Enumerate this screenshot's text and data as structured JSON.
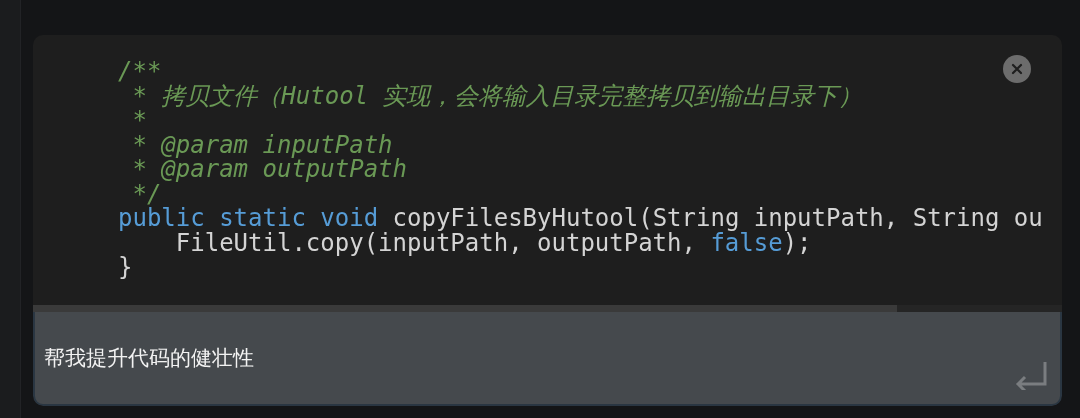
{
  "code_lines": [
    [
      {
        "kind": "comment",
        "text": "/**"
      }
    ],
    [
      {
        "kind": "comment",
        "text": " * 拷贝文件（Hutool 实现，会将输入目录完整拷贝到输出目录下）"
      }
    ],
    [
      {
        "kind": "comment",
        "text": " *"
      }
    ],
    [
      {
        "kind": "comment",
        "text": " * @param inputPath"
      }
    ],
    [
      {
        "kind": "comment",
        "text": " * @param outputPath"
      }
    ],
    [
      {
        "kind": "comment",
        "text": " */"
      }
    ],
    [
      {
        "kind": "keyword",
        "text": "public static void"
      },
      {
        "kind": "plain",
        "text": " copyFilesByHutool(String inputPath, String ou"
      }
    ],
    [
      {
        "kind": "plain",
        "text": "    FileUtil.copy(inputPath, outputPath, "
      },
      {
        "kind": "keyword",
        "text": "false"
      },
      {
        "kind": "plain",
        "text": ");"
      }
    ],
    [
      {
        "kind": "plain",
        "text": "}"
      }
    ]
  ],
  "prompt": {
    "value": "帮我提升代码的健壮性"
  }
}
